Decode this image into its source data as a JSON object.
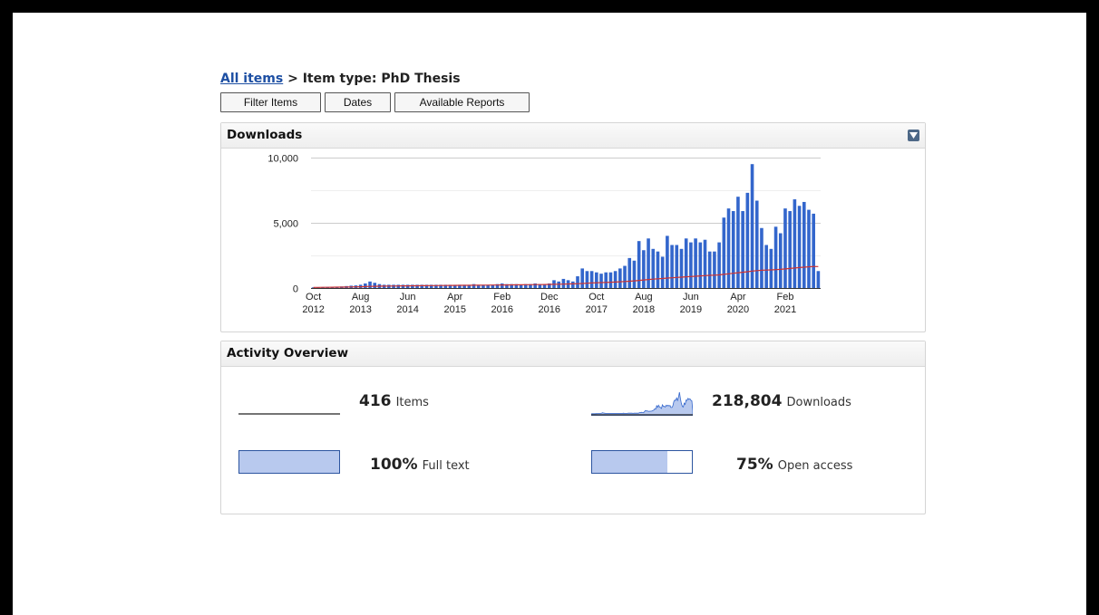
{
  "breadcrumb": {
    "link": "All items",
    "separator": " > ",
    "current": "Item type: PhD Thesis"
  },
  "toolbar": {
    "filter": "Filter Items",
    "dates": "Dates",
    "reports": "Available Reports"
  },
  "downloads_panel": {
    "title": "Downloads",
    "toggle_icon": "collapse-toggle-icon"
  },
  "overview_panel": {
    "title": "Activity Overview"
  },
  "overview": {
    "items": {
      "value": "416",
      "label": "Items"
    },
    "downloads": {
      "value": "218,804",
      "label": "Downloads"
    },
    "fulltext": {
      "value": "100%",
      "label": "Full text",
      "fraction": 1.0
    },
    "openaccess": {
      "value": "75%",
      "label": "Open access",
      "fraction": 0.75
    }
  },
  "colors": {
    "bar": "#3366cc",
    "trend": "#cc3333",
    "link": "#1d4fa3",
    "accent_fill": "#b8c9ee"
  },
  "chart_data": {
    "type": "bar",
    "title": "Downloads",
    "ylim": [
      0,
      10000
    ],
    "yticks": [
      "0",
      "5,000",
      "10,000"
    ],
    "ytick_values": [
      0,
      5000,
      10000
    ],
    "xtick_labels": [
      [
        "Oct",
        "2012"
      ],
      [
        "Aug",
        "2013"
      ],
      [
        "Jun",
        "2014"
      ],
      [
        "Apr",
        "2015"
      ],
      [
        "Feb",
        "2016"
      ],
      [
        "Dec",
        "2016"
      ],
      [
        "Oct",
        "2017"
      ],
      [
        "Aug",
        "2018"
      ],
      [
        "Jun",
        "2019"
      ],
      [
        "Apr",
        "2020"
      ],
      [
        "Feb",
        "2021"
      ]
    ],
    "xtick_index": [
      0,
      10,
      20,
      30,
      40,
      50,
      60,
      70,
      80,
      90,
      100
    ],
    "grid": true,
    "series": [
      {
        "type": "bar",
        "values": [
          50,
          60,
          70,
          80,
          90,
          100,
          120,
          150,
          180,
          200,
          250,
          350,
          500,
          400,
          300,
          250,
          250,
          250,
          250,
          250,
          250,
          250,
          250,
          250,
          250,
          250,
          250,
          250,
          250,
          250,
          250,
          250,
          250,
          250,
          300,
          250,
          250,
          250,
          250,
          300,
          350,
          300,
          300,
          300,
          250,
          300,
          300,
          350,
          300,
          300,
          350,
          600,
          500,
          700,
          600,
          500,
          900,
          1500,
          1300,
          1300,
          1200,
          1100,
          1200,
          1200,
          1300,
          1500,
          1700,
          2300,
          2100,
          3600,
          2900,
          3800,
          3000,
          2800,
          2400,
          4000,
          3300,
          3300,
          3000,
          3800,
          3500,
          3800,
          3500,
          3700,
          2800,
          2800,
          3500,
          5400,
          6100,
          5900,
          7000,
          5900,
          7300,
          9500,
          6700,
          4600,
          3300,
          3000,
          4700,
          4200,
          6100,
          5900,
          6800,
          6300,
          6600,
          6000,
          5700,
          1300
        ]
      },
      {
        "type": "line",
        "values": [
          50,
          52,
          54,
          58,
          62,
          66,
          70,
          75,
          82,
          90,
          98,
          108,
          122,
          132,
          140,
          146,
          151,
          156,
          160,
          164,
          168,
          172,
          175,
          179,
          182,
          186,
          189,
          192,
          196,
          199,
          202,
          205,
          208,
          211,
          214,
          217,
          220,
          223,
          226,
          230,
          234,
          238,
          242,
          246,
          250,
          254,
          258,
          262,
          266,
          270,
          276,
          284,
          292,
          302,
          310,
          318,
          330,
          350,
          368,
          386,
          402,
          416,
          430,
          445,
          460,
          478,
          498,
          524,
          548,
          586,
          616,
          652,
          680,
          706,
          728,
          762,
          786,
          810,
          832,
          860,
          882,
          906,
          930,
          952,
          970,
          988,
          1010,
          1050,
          1090,
          1130,
          1172,
          1210,
          1250,
          1300,
          1336,
          1360,
          1376,
          1390,
          1412,
          1430,
          1466,
          1498,
          1534,
          1566,
          1600,
          1628,
          1654,
          1645
        ]
      }
    ]
  }
}
